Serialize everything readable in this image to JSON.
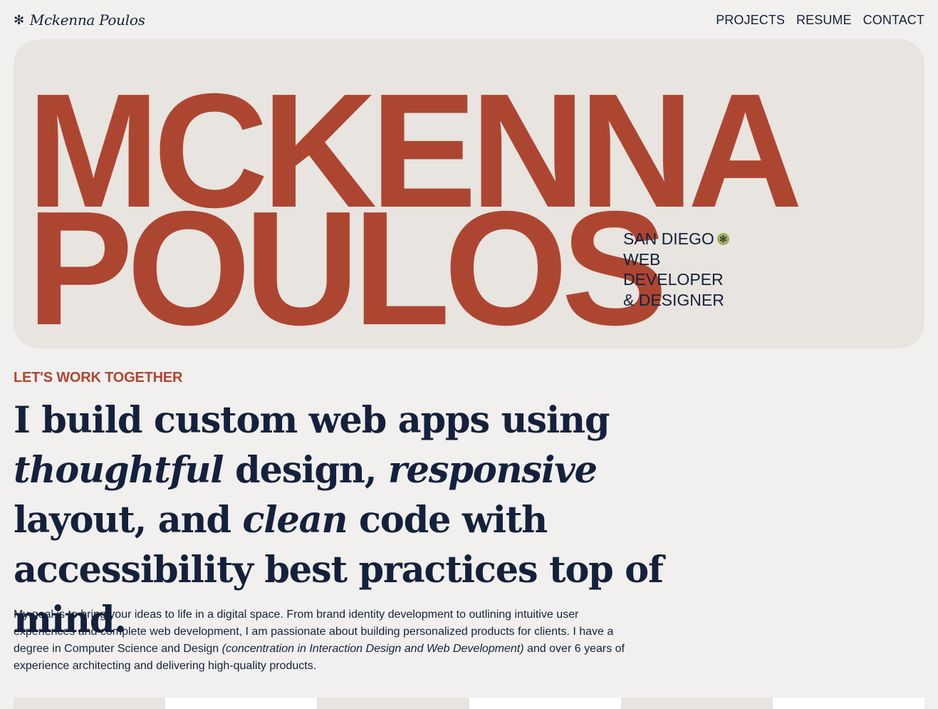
{
  "header": {
    "brand_mark": "✻",
    "brand_name": "Mckenna Poulos",
    "nav": [
      "PROJECTS",
      "RESUME",
      "CONTACT"
    ]
  },
  "hero": {
    "first_name": "MCKENNA",
    "last_name": "POULOS",
    "tagline": [
      "SAN DIEGO",
      "WEB",
      "DEVELOPER",
      "& DESIGNER"
    ],
    "badge_icon": "✻"
  },
  "intro": {
    "kicker": "LET'S WORK TOGETHER",
    "headline_parts": [
      "I build custom web apps using ",
      "thoughtful",
      " design, ",
      "responsive",
      " layout, and ",
      "clean",
      " code with accessibility best practices top of mind."
    ],
    "bio_parts": [
      "My goal is to bring your ideas to life in a digital space. From brand identity development to outlining intuitive user experiences and complete web development, I am passionate about building personalized products for clients. I have a degree in Computer Science and Design ",
      "(concentration in Interaction Design and Web Development)",
      " and over 6 years of experience architecting and delivering high-quality products."
    ]
  },
  "colors": {
    "background": "#f2f0ee",
    "hero_card": "#e8e4df",
    "accent": "#ad4631",
    "text": "#14213d",
    "badge": "#a3ad5b"
  },
  "strip_colors": [
    "#e8e4df",
    "#ffffff",
    "#e8e4df",
    "#ffffff",
    "#e8e4df",
    "#ffffff"
  ]
}
